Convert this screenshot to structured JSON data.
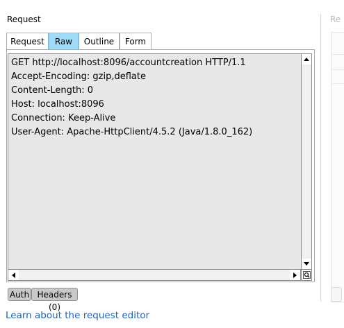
{
  "panel": {
    "title": "Request"
  },
  "right_pane": {
    "title": "Re"
  },
  "tabs": [
    {
      "label": "Request",
      "active": false
    },
    {
      "label": "Raw",
      "active": true
    },
    {
      "label": "Outline",
      "active": false
    },
    {
      "label": "Form",
      "active": false
    }
  ],
  "editor": {
    "lines": [
      "GET http://localhost:8096/accountcreation HTTP/1.1",
      "Accept-Encoding: gzip,deflate",
      "Content-Length: 0",
      "Host: localhost:8096",
      "Connection: Keep-Alive",
      "User-Agent: Apache-HttpClient/4.5.2 (Java/1.8.0_162)"
    ],
    "background": "#e8e8e8"
  },
  "bottom_tabs": [
    {
      "label": "Auth"
    },
    {
      "label": "Headers (0)"
    }
  ],
  "footer": {
    "link": "Learn about the request editor"
  },
  "colors": {
    "active_tab": "#9fdcf7",
    "link": "#1c62b8"
  },
  "icons": {
    "scroll_up": "triangle-up",
    "scroll_down": "triangle-down",
    "scroll_left": "triangle-left",
    "scroll_right": "triangle-right",
    "corner": "zoom-icon"
  }
}
